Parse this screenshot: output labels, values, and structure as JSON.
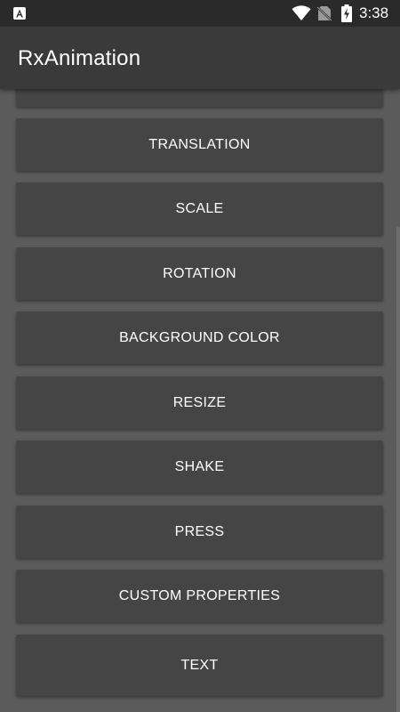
{
  "status_bar": {
    "time": "3:38",
    "icons": [
      "notification-a-icon",
      "wifi-icon",
      "no-sim-icon",
      "battery-charging-icon"
    ]
  },
  "app_bar": {
    "title": "RxAnimation"
  },
  "buttons": [
    {
      "id": "partial",
      "label": ""
    },
    {
      "id": "translation",
      "label": "TRANSLATION"
    },
    {
      "id": "scale",
      "label": "SCALE"
    },
    {
      "id": "rotation",
      "label": "ROTATION"
    },
    {
      "id": "background-color",
      "label": "BACKGROUND COLOR"
    },
    {
      "id": "resize",
      "label": "RESIZE"
    },
    {
      "id": "shake",
      "label": "SHAKE"
    },
    {
      "id": "press",
      "label": "PRESS"
    },
    {
      "id": "custom-properties",
      "label": "CUSTOM PROPERTIES"
    },
    {
      "id": "text",
      "label": "TEXT"
    }
  ],
  "colors": {
    "background": "#5b5b5b",
    "app_bar": "#3a3a3a",
    "status_bar": "#2a2a2a",
    "button": "#454545",
    "text": "#ffffff"
  }
}
